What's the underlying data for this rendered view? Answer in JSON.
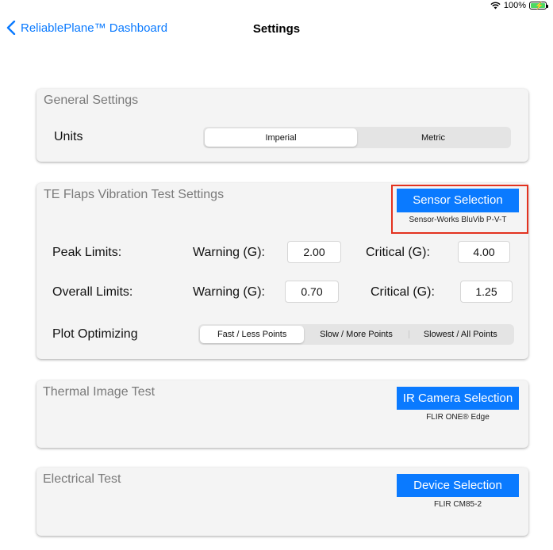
{
  "status": {
    "battery": "100%"
  },
  "nav": {
    "back_label": "ReliablePlane™ Dashboard",
    "title": "Settings"
  },
  "general": {
    "title": "General Settings",
    "units_label": "Units",
    "units_options": [
      "Imperial",
      "Metric"
    ],
    "units_selected": "Imperial"
  },
  "te_flaps": {
    "title": "TE Flaps Vibration Test Settings",
    "sensor_button": "Sensor Selection",
    "sensor_name": "Sensor-Works BluVib P-V-T",
    "peak_label": "Peak Limits:",
    "overall_label": "Overall Limits:",
    "warning_label": "Warning (G):",
    "critical_label": "Critical (G):",
    "peak_warning": "2.00",
    "peak_critical": "4.00",
    "overall_warning": "0.70",
    "overall_critical": "1.25",
    "plot_label": "Plot Optimizing",
    "plot_options": [
      "Fast / Less Points",
      "Slow / More Points",
      "Slowest / All Points"
    ],
    "plot_selected": "Fast / Less Points"
  },
  "thermal": {
    "title": "Thermal Image Test",
    "button": "IR Camera Selection",
    "device": "FLIR ONE® Edge"
  },
  "electrical": {
    "title": "Electrical Test",
    "button": "Device Selection",
    "device": "FLIR CM85-2"
  },
  "colors": {
    "accent": "#0a7aff",
    "highlight": "#e3321f",
    "card_bg": "#f4f4f4"
  }
}
